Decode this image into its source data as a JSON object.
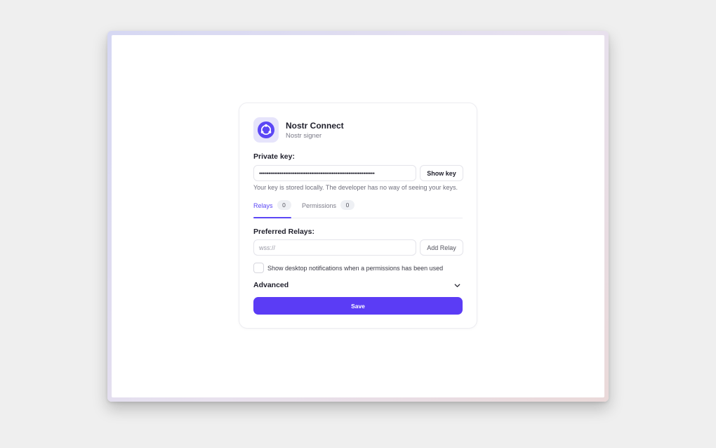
{
  "brand": {
    "name": "Nostr Connect",
    "subtitle": "Nostr signer",
    "logo_icon": "nostr-connect-logo-icon",
    "accent_color": "#5b3cf5"
  },
  "private_key": {
    "label": "Private key:",
    "masked_value": "••••••••••••••••••••••••••••••••••••••••••••••••••••••••••••••",
    "show_button": "Show key",
    "hint": "Your key is stored locally. The developer has no way of seeing your keys."
  },
  "tabs": [
    {
      "label": "Relays",
      "count": "0",
      "active": true
    },
    {
      "label": "Permissions",
      "count": "0",
      "active": false
    }
  ],
  "relays": {
    "label": "Preferred Relays:",
    "placeholder": "wss://",
    "add_button": "Add Relay"
  },
  "notifications": {
    "label": "Show desktop notifications when a permissions has been used",
    "checked": false
  },
  "advanced": {
    "label": "Advanced",
    "icon": "chevron-down-icon"
  },
  "save_button": "Save"
}
